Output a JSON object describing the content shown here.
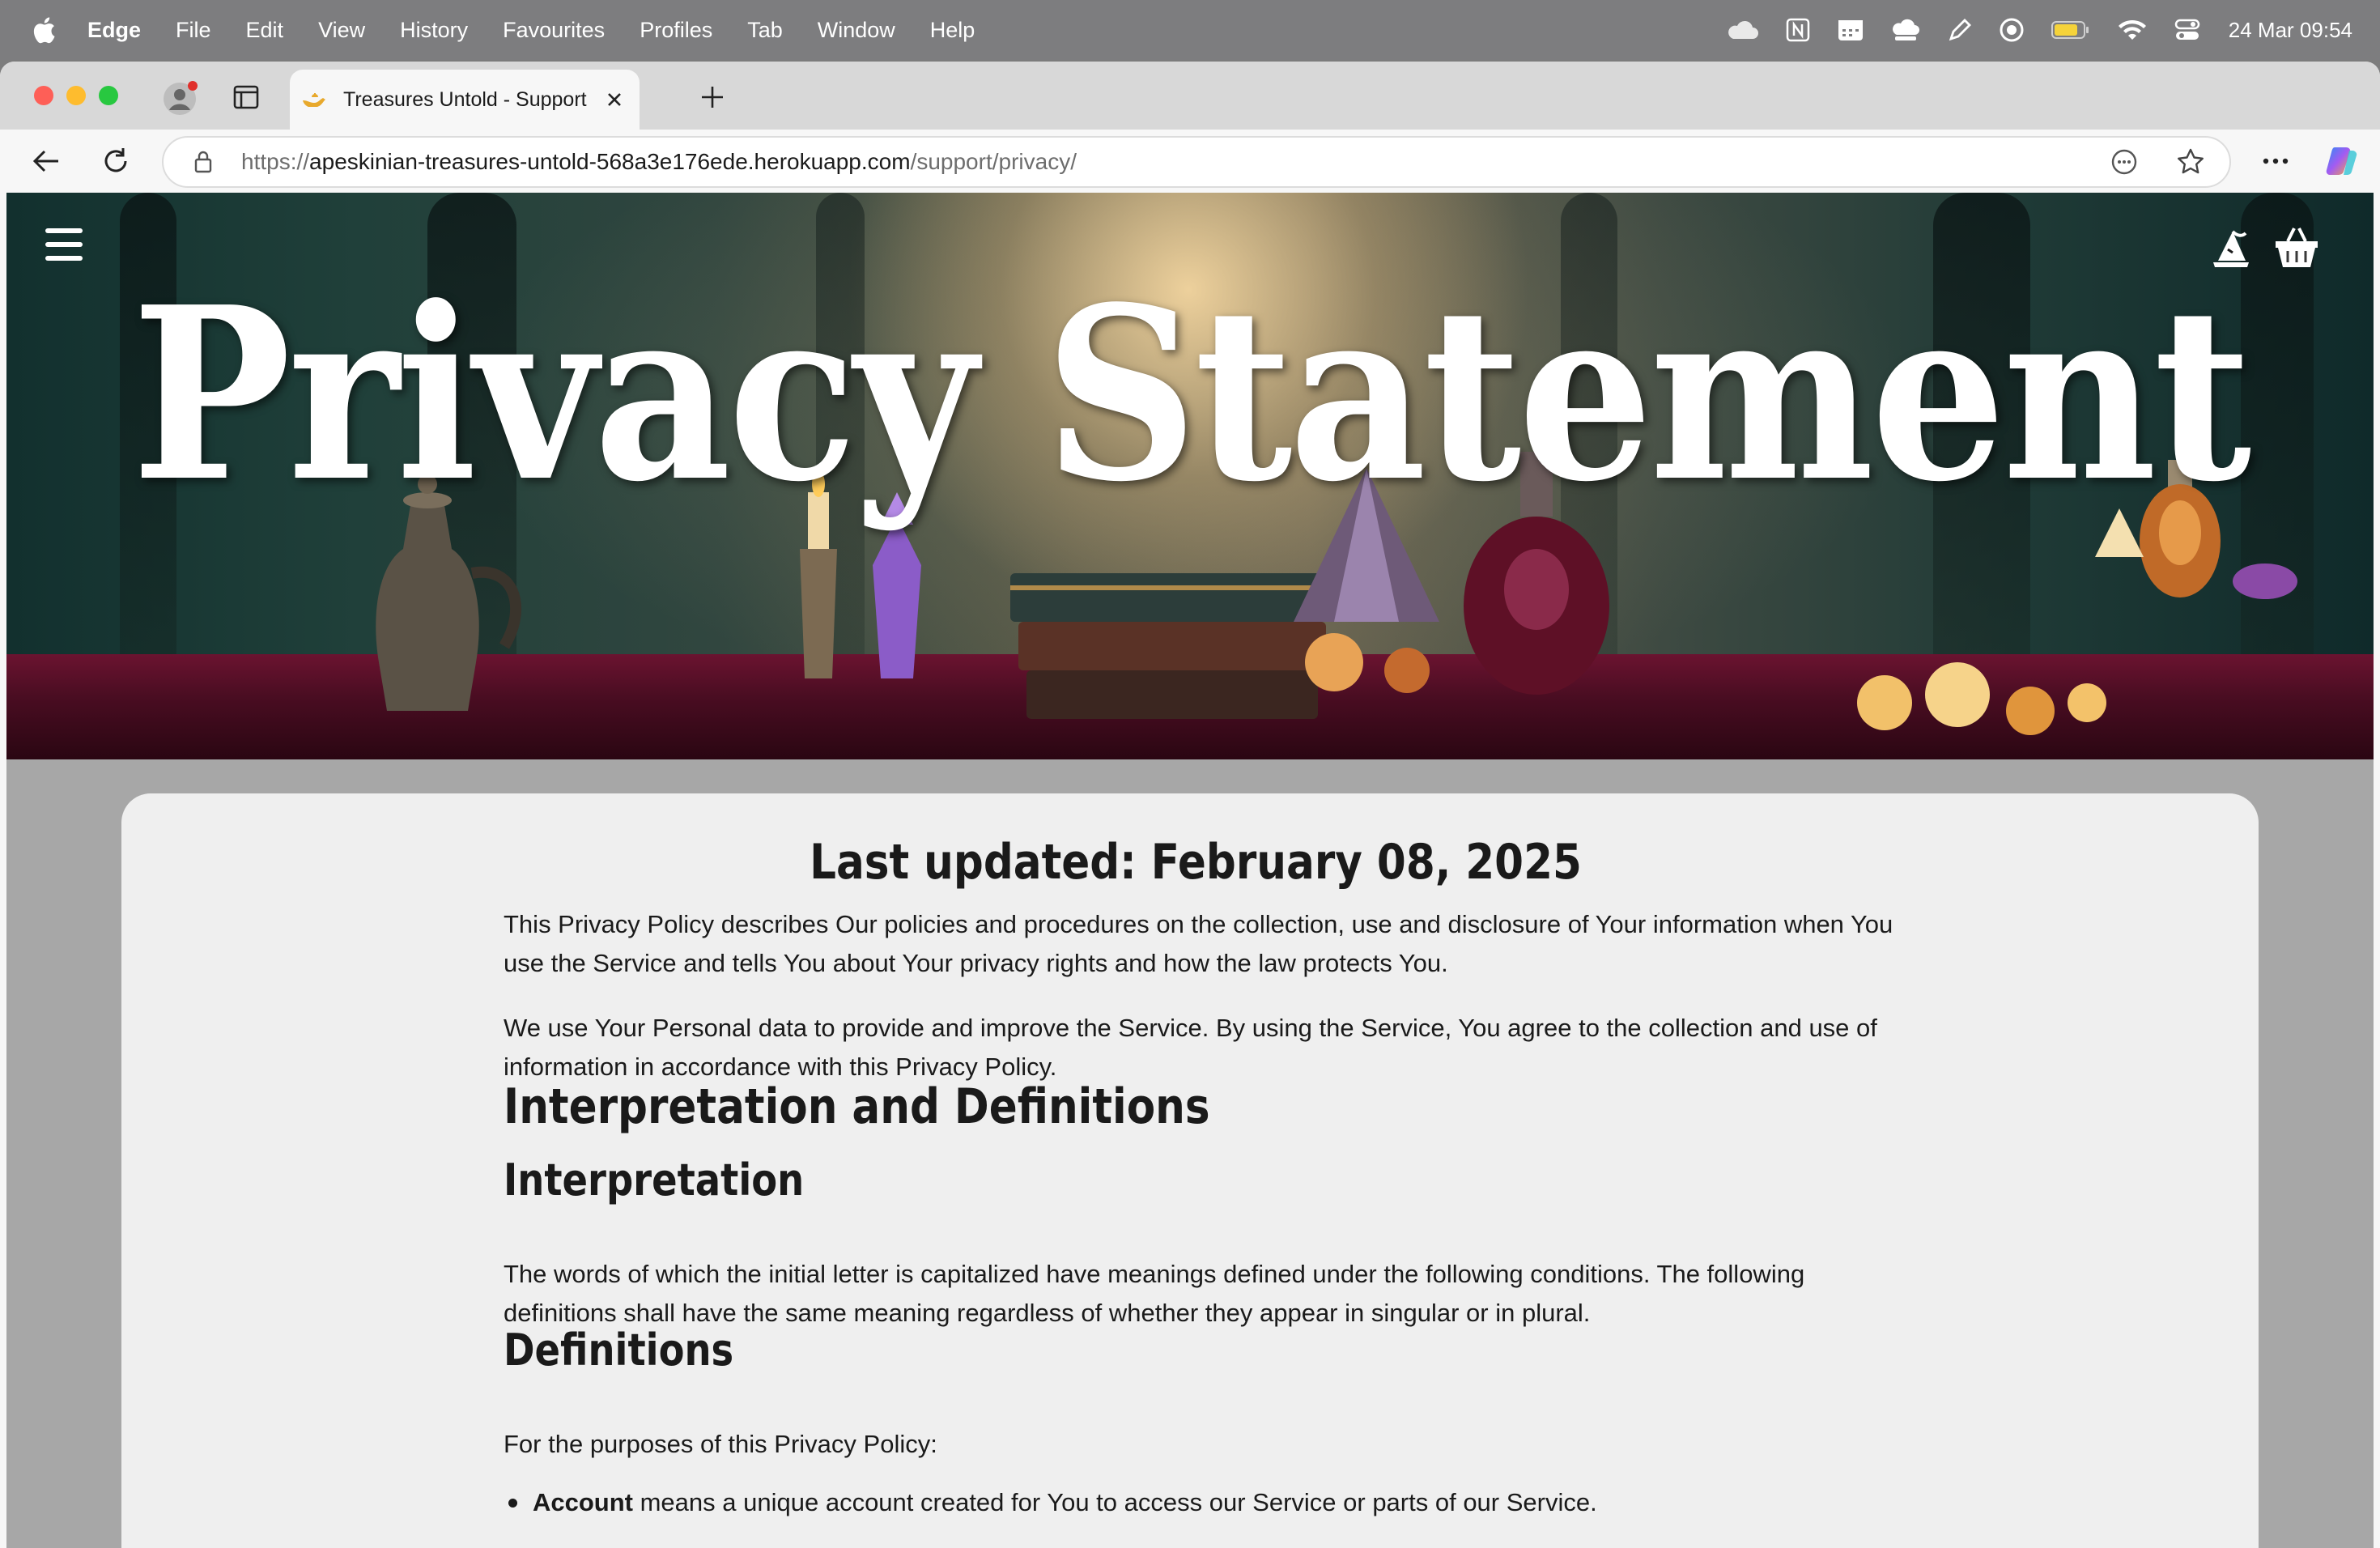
{
  "menubar": {
    "app_name": "Edge",
    "menus": [
      "File",
      "Edit",
      "View",
      "History",
      "Favourites",
      "Profiles",
      "Tab",
      "Window",
      "Help"
    ],
    "status_icons": [
      "icloud-icon",
      "notion-icon",
      "calendar-icon",
      "cloud-sync-icon",
      "pencil-icon",
      "screen-record-icon",
      "battery-icon",
      "wifi-icon",
      "control-center-icon"
    ],
    "clock": "24 Mar  09:54"
  },
  "browser": {
    "tab": {
      "title": "Treasures Untold - Support"
    },
    "address": {
      "scheme": "https://",
      "host": "apeskinian-treasures-untold-568a3e176ede.herokuapp.com",
      "path": "/support/privacy/"
    }
  },
  "page": {
    "hero_title": "Privacy Statement",
    "last_updated": "Last updated: February 08, 2025",
    "intro_1": "This Privacy Policy describes Our policies and procedures on the collection, use and disclosure of Your information when You use the Service and tells You about Your privacy rights and how the law protects You.",
    "intro_2": "We use Your Personal data to provide and improve the Service. By using the Service, You agree to the collection and use of information in accordance with this Privacy Policy.",
    "h_interp_defs": "Interpretation and Definitions",
    "h_interpretation": "Interpretation",
    "interpretation_text": "The words of which the initial letter is capitalized have meanings defined under the following conditions. The following definitions shall have the same meaning regardless of whether they appear in singular or in plural.",
    "h_definitions": "Definitions",
    "definitions_intro": "For the purposes of this Privacy Policy:",
    "definition_items": [
      {
        "term": "Account",
        "text": " means a unique account created for You to access our Service or parts of our Service."
      }
    ]
  },
  "colors": {
    "menubar_bg": "#7d7d7f",
    "card_bg": "#efefef",
    "page_bg": "#a7a7a7",
    "text": "#1a1a1a"
  }
}
